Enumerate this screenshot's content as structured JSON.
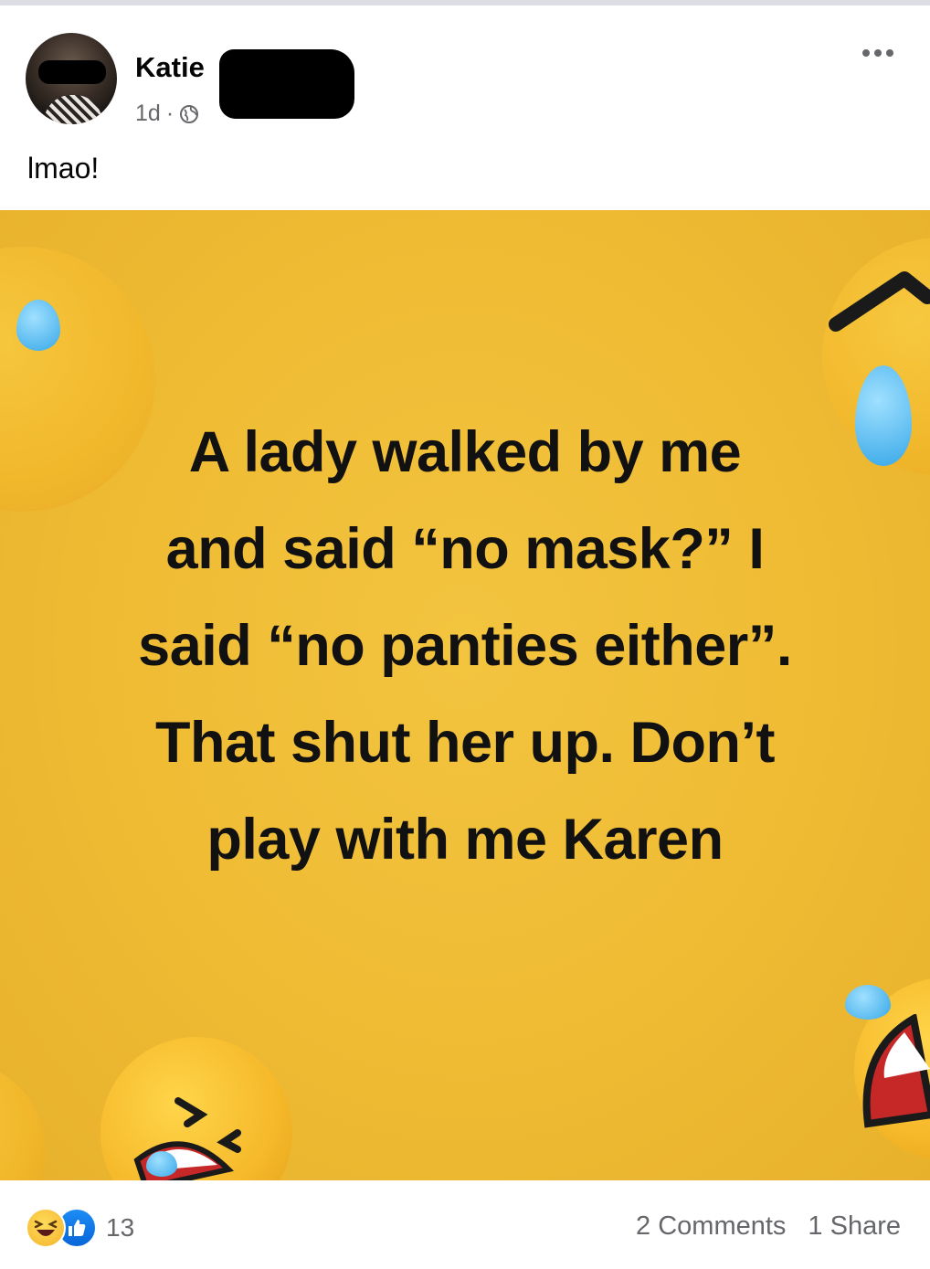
{
  "post": {
    "author": "Katie",
    "time": "1d",
    "separator": "·",
    "caption": "lmao!",
    "privacy_icon": "globe-icon",
    "menu_icon": "more-horizontal-icon"
  },
  "image": {
    "lines": [
      "A lady walked by me",
      "and said “no mask?” I",
      "said “no panties either”.",
      "That shut her up. Don’t",
      "play with me Karen"
    ],
    "background_color": "#efbb33"
  },
  "footer": {
    "reaction_icons": [
      "haha-icon",
      "like-icon"
    ],
    "reaction_count": "13",
    "comments": "2 Comments",
    "shares": "1 Share"
  }
}
